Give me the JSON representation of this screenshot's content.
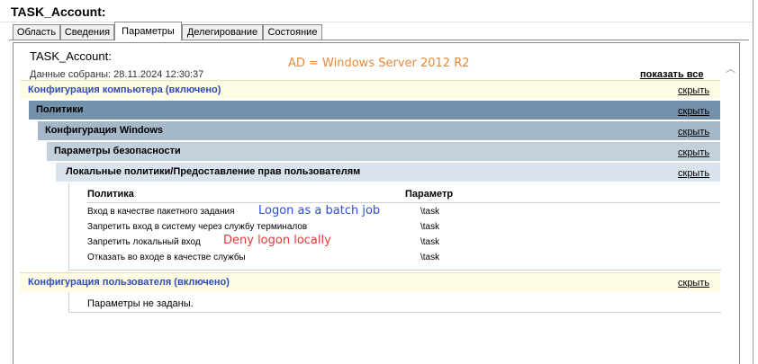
{
  "window": {
    "title": "TASK_Account:"
  },
  "tabs": [
    "Область",
    "Сведения",
    "Параметры",
    "Делегирование",
    "Состояние"
  ],
  "report": {
    "name": "TASK_Account:",
    "collected": "Данные собраны: 28.11.2024 12:30:37",
    "show_all": "показать все",
    "hide_label": "скрыть"
  },
  "annotations": {
    "ad_version": "AD = Windows Server 2012 R2",
    "batch_logon": "Logon as a batch job",
    "deny_local": "Deny logon locally"
  },
  "sections": {
    "computer": "Конфигурация компьютера (включено)",
    "policies": "Политики",
    "windows_config": "Конфигурация Windows",
    "security_settings": "Параметры безопасности",
    "user_rights": "Локальные политики/Предоставление прав пользователям",
    "user": "Конфигурация пользователя (включено)"
  },
  "table": {
    "headers": [
      "Политика",
      "Параметр"
    ],
    "rows": [
      {
        "policy": "Вход в качестве пакетного задания",
        "value": "\\task"
      },
      {
        "policy": "Запретить вход в систему через службу терминалов",
        "value": "\\task"
      },
      {
        "policy": "Запретить локальный вход",
        "value": "\\task"
      },
      {
        "policy": "Отказать во входе в качестве службы",
        "value": "\\task"
      }
    ]
  },
  "user_config": {
    "empty_text": "Параметры не заданы."
  },
  "colors": {
    "annotation_orange": "#e58a3c",
    "annotation_blue": "#2d4fd6",
    "annotation_red": "#e53935",
    "link_blue": "#2e4bb4"
  }
}
